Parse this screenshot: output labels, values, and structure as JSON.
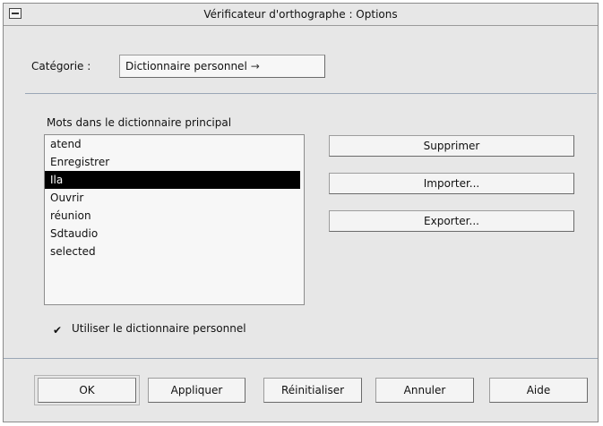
{
  "window": {
    "title": "Vérificateur d'orthographe : Options",
    "menu_icon": "window-menu-icon"
  },
  "category": {
    "label": "Catégorie :",
    "selected": "Dictionnaire personnel",
    "arrow": "→"
  },
  "list": {
    "label": "Mots dans le dictionnaire principal",
    "items": [
      {
        "text": "atend",
        "selected": false
      },
      {
        "text": "Enregistrer",
        "selected": false
      },
      {
        "text": "Ila",
        "selected": true
      },
      {
        "text": "Ouvrir",
        "selected": false
      },
      {
        "text": "réunion",
        "selected": false
      },
      {
        "text": "Sdtaudio",
        "selected": false
      },
      {
        "text": "selected",
        "selected": false
      }
    ]
  },
  "actions": {
    "delete": "Supprimer",
    "import": "Importer...",
    "export": "Exporter..."
  },
  "checkbox": {
    "mark": "✔",
    "label": "Utiliser le dictionnaire personnel",
    "checked": true
  },
  "footer": {
    "ok": "OK",
    "apply": "Appliquer",
    "reset": "Réinitialiser",
    "cancel": "Annuler",
    "help": "Aide"
  }
}
